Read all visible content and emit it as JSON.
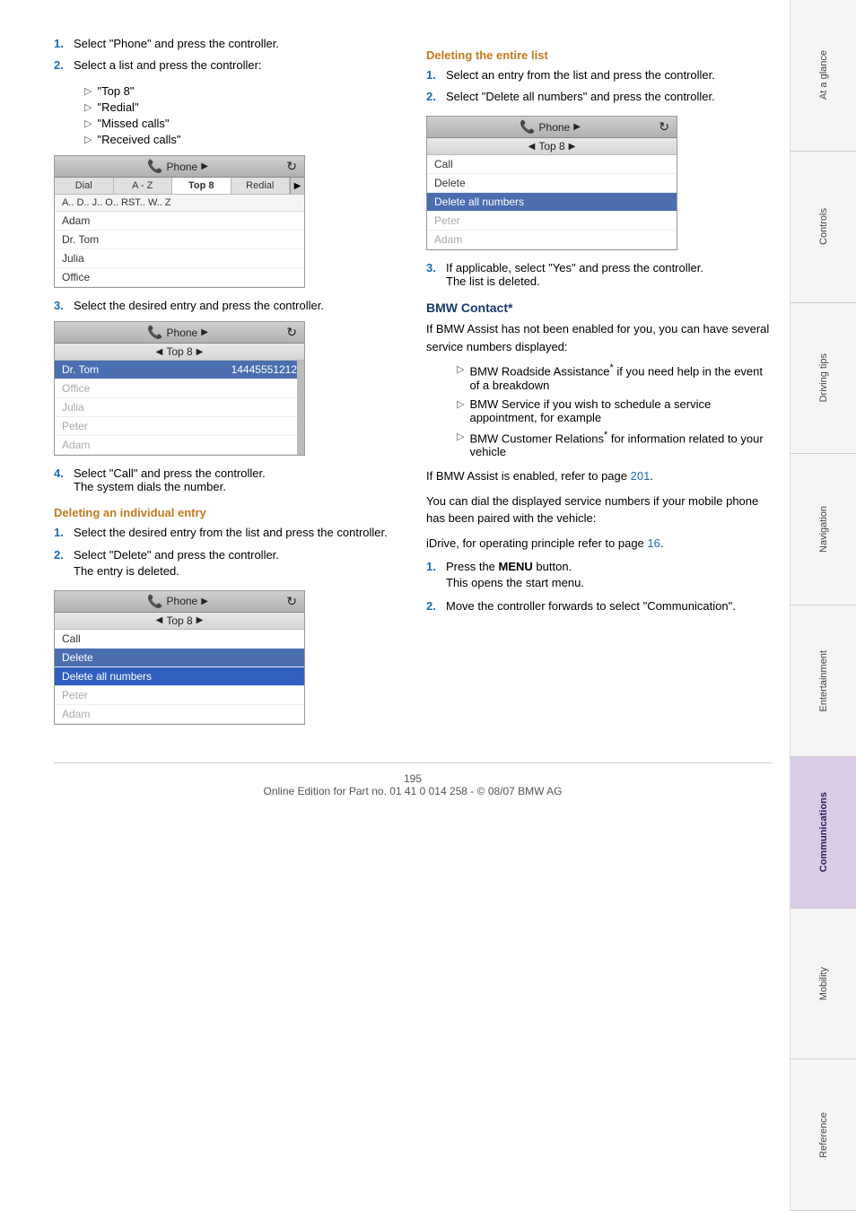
{
  "page": {
    "number": "195",
    "footer": "Online Edition for Part no. 01 41 0 014 258 - © 08/07 BMW AG"
  },
  "sidebar": {
    "tabs": [
      {
        "id": "at-a-glance",
        "label": "At a glance",
        "active": false
      },
      {
        "id": "controls",
        "label": "Controls",
        "active": false
      },
      {
        "id": "driving-tips",
        "label": "Driving tips",
        "active": false
      },
      {
        "id": "navigation",
        "label": "Navigation",
        "active": false
      },
      {
        "id": "entertainment",
        "label": "Entertainment",
        "active": false
      },
      {
        "id": "communications",
        "label": "Communications",
        "active": true
      },
      {
        "id": "mobility",
        "label": "Mobility",
        "active": false
      },
      {
        "id": "reference",
        "label": "Reference",
        "active": false
      }
    ]
  },
  "left_col": {
    "steps_top": [
      {
        "num": "1.",
        "text": "Select \"Phone\" and press the controller."
      },
      {
        "num": "2.",
        "text": "Select a list and press the controller:"
      }
    ],
    "bullet_items": [
      "\"Top 8\"",
      "\"Redial\"",
      "\"Missed calls\"",
      "\"Received calls\""
    ],
    "step3": {
      "num": "3.",
      "text": "Select the desired entry and press the controller."
    },
    "screen1": {
      "title": "Phone",
      "subtitle": "Top 8",
      "tabs": [
        "Dial",
        "A - Z",
        "Top 8",
        "Redial"
      ],
      "active_tab": "Top 8",
      "alphabar": "A..  D..  J..  O..  RST..  W..  Z",
      "items": [
        "Adam",
        "Dr. Tom",
        "Julia",
        "Office"
      ],
      "selected_item": null
    },
    "screen2": {
      "title": "Phone",
      "subtitle": "Top 8",
      "selected_name": "Dr. Tom",
      "selected_number": "14445551212",
      "items": [
        "Office",
        "Julia",
        "Peter",
        "Adam"
      ]
    },
    "step4": {
      "num": "4.",
      "text": "Select \"Call\" and press the controller.\nThe system dials the number."
    },
    "deleting_individual": {
      "header": "Deleting an individual entry",
      "steps": [
        {
          "num": "1.",
          "text": "Select the desired entry from the list and press the controller."
        },
        {
          "num": "2.",
          "text": "Select \"Delete\" and press the controller.\nThe entry is deleted."
        }
      ]
    },
    "screen3": {
      "title": "Phone",
      "subtitle": "Top 8",
      "menu_items": [
        "Call",
        "Delete",
        "Delete all numbers",
        "Peter",
        "Adam"
      ],
      "selected_item": "Delete",
      "highlighted_item": "Delete all numbers"
    }
  },
  "right_col": {
    "deleting_entire": {
      "header": "Deleting the entire list",
      "steps": [
        {
          "num": "1.",
          "text": "Select an entry from the list and press the controller."
        },
        {
          "num": "2.",
          "text": "Select \"Delete all numbers\" and press the controller."
        }
      ]
    },
    "screen4": {
      "title": "Phone",
      "subtitle": "Top 8",
      "menu_items": [
        "Call",
        "Delete",
        "Delete all numbers",
        "Peter",
        "Adam"
      ],
      "selected_item": "Delete all numbers"
    },
    "step3": {
      "num": "3.",
      "text": "If applicable, select \"Yes\" and press the controller.\nThe list is deleted."
    },
    "bmw_contact": {
      "header": "BMW Contact*",
      "intro": "If BMW Assist has not been enabled for you, you can have several service numbers displayed:",
      "bullets": [
        "BMW Roadside Assistance* if you need help in the event of a breakdown",
        "BMW Service if you wish to schedule a service appointment, for example",
        "BMW Customer Relations* for information related to your vehicle"
      ],
      "para1": "If BMW Assist is enabled, refer to page 201.",
      "para2": "You can dial the displayed service numbers if your mobile phone has been paired with the vehicle:",
      "para3": "iDrive, for operating principle refer to page 16.",
      "steps": [
        {
          "num": "1.",
          "text": "Press the MENU button.\nThis opens the start menu."
        },
        {
          "num": "2.",
          "text": "Move the controller forwards to select \"Communication\"."
        }
      ],
      "page_ref1": "201",
      "page_ref2": "16"
    }
  }
}
